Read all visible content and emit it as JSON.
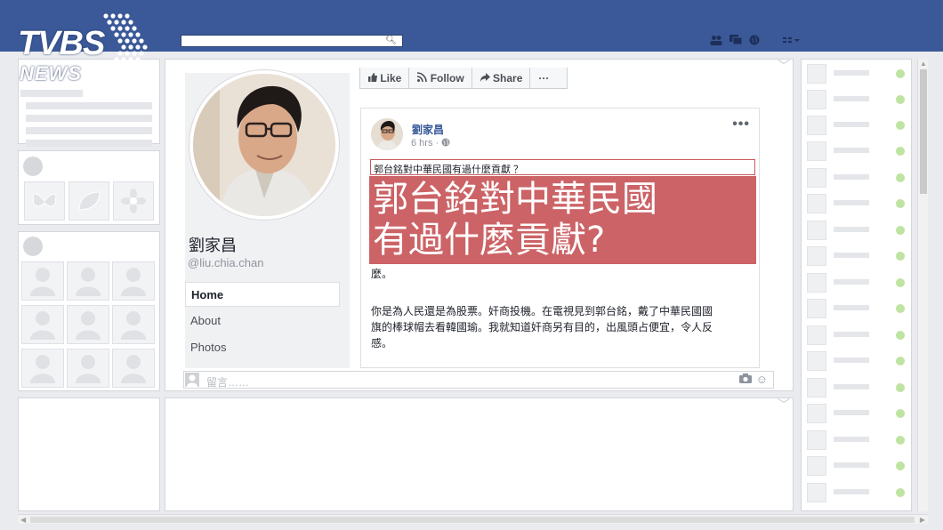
{
  "watermark": {
    "brand": "TVBS",
    "sub": "NEWS"
  },
  "topbar": {
    "search_placeholder": "",
    "search_icon": "search-icon"
  },
  "profile": {
    "name": "劉家昌",
    "handle": "@liu.chia.chan",
    "nav": [
      "Home",
      "About",
      "Photos"
    ]
  },
  "actions": {
    "like": "Like",
    "follow": "Follow",
    "share": "Share",
    "more": "···"
  },
  "post": {
    "author": "劉家昌",
    "time": "6 hrs ·",
    "quote": "郭台銘對中華民國有過什麼貢獻 ？",
    "banner_line1": "郭台銘對中華民國",
    "banner_line2": "有過什麼貢獻?",
    "text_fragment": "麼。",
    "text_line1": "你是為人民還是為股票。奸商投機。在電視見到郭台銘，戴了中華民國國",
    "text_line2": "旗的棒球帽去看韓國瑜。我就知道奸商另有目的，出風頭占便宜，令人反",
    "text_line3": "感。"
  },
  "comment": {
    "placeholder": "留言……"
  },
  "colors": {
    "topbar": "#3b5998",
    "banner": "#cc6366",
    "online": "#bfe3a1"
  }
}
